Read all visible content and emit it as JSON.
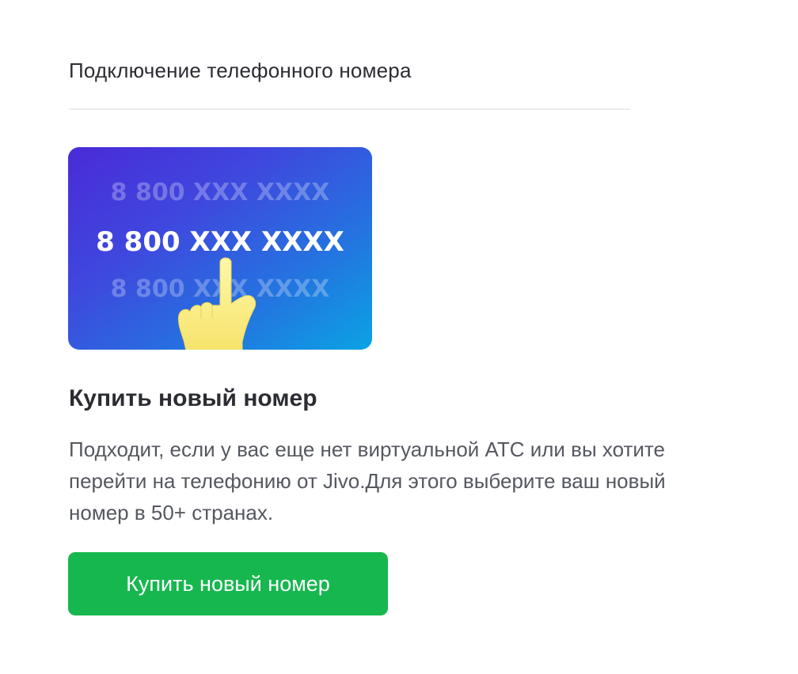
{
  "header": {
    "title": "Подключение телефонного номера"
  },
  "promo": {
    "numbers": [
      "8 800 XXX XXXX",
      "8 800 XXX XXXX",
      "8 800 XXX XXXX"
    ],
    "gradient_colors": [
      "#4a2bd8",
      "#2474e0",
      "#0aa3e3"
    ],
    "pointer_icon": "hand-pointer-icon"
  },
  "option": {
    "title": "Купить новый номер",
    "description": "Подходит, если у вас еще нет виртуальной АТС или вы хотите перейти на телефонию от Jivo.Для этого выберите ваш новый номер в 50+ странах.",
    "button_label": "Купить новый номер",
    "button_color": "#17b750"
  }
}
